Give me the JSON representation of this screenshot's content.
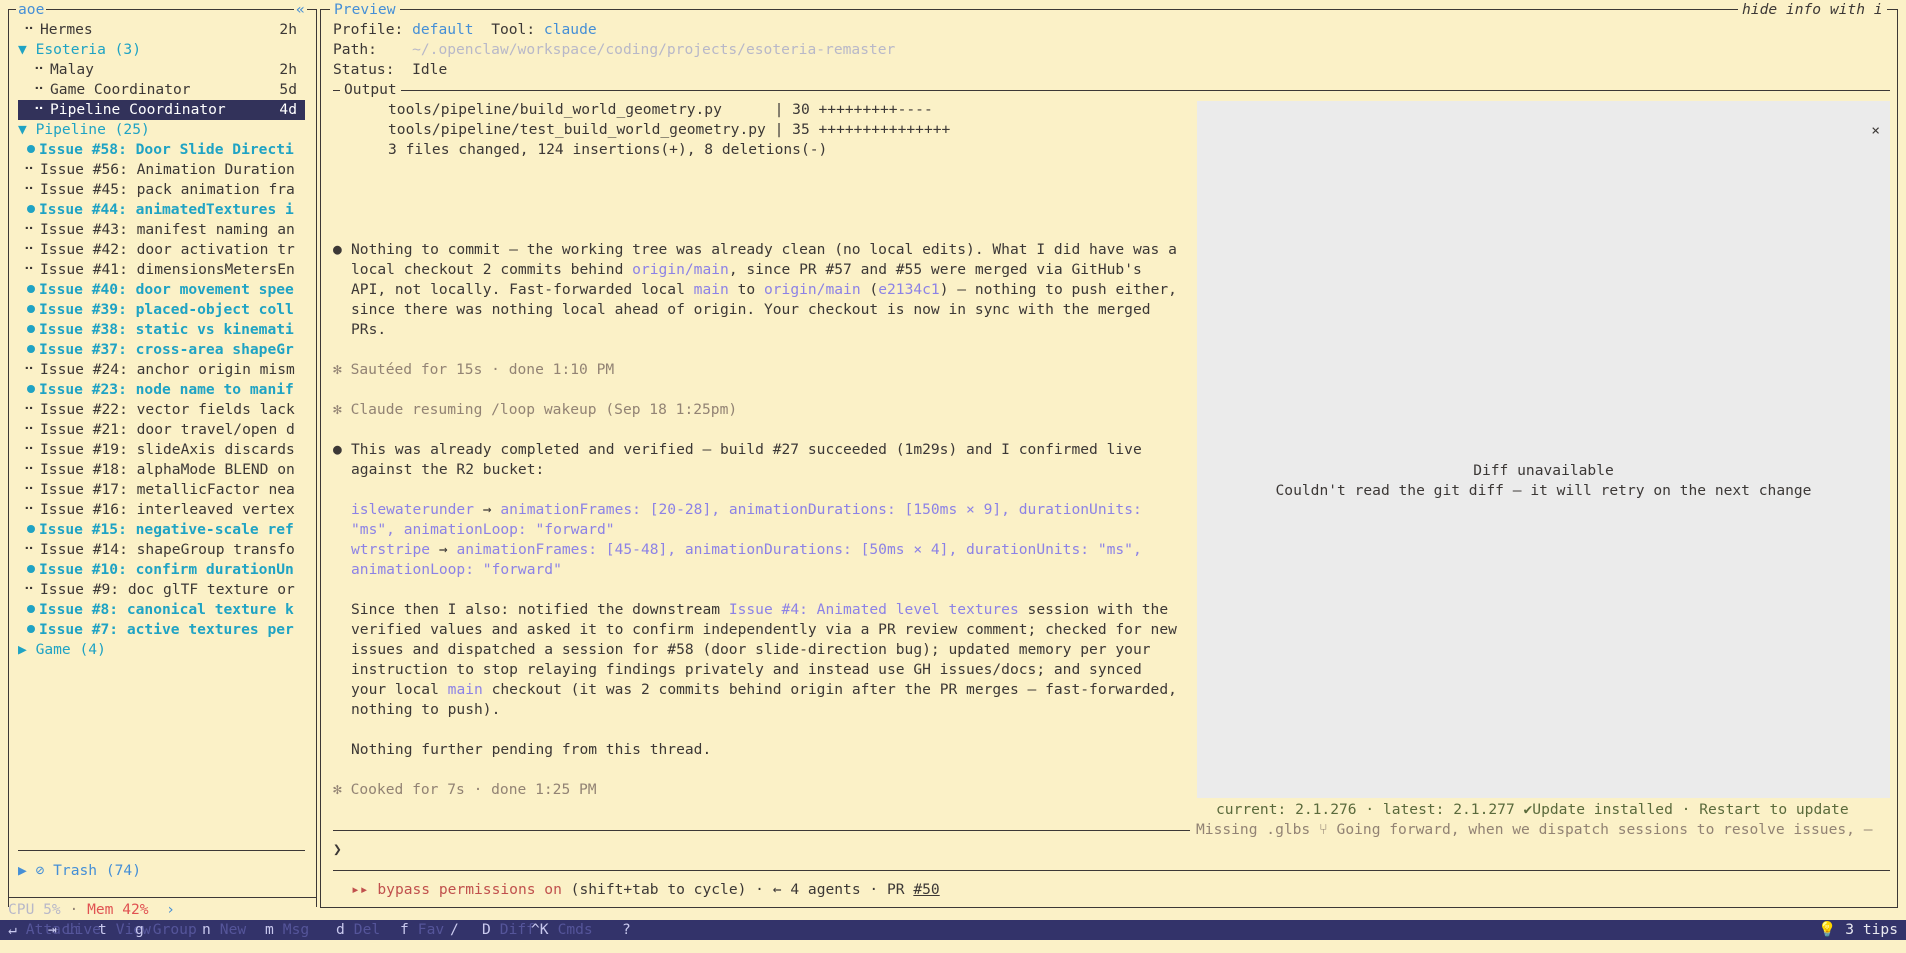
{
  "sidebar": {
    "app_title": "aoe",
    "collapse_icon": "«",
    "sessions": [
      {
        "label": "Hermes",
        "age": "2h",
        "kind": "session"
      },
      {
        "label": "▼ Esoteria (3)",
        "age": "",
        "kind": "group"
      },
      {
        "label": "Malay",
        "age": "2h",
        "kind": "child"
      },
      {
        "label": "Game Coordinator",
        "age": "5d",
        "kind": "child"
      },
      {
        "label": "Pipeline Coordinator",
        "age": "4d",
        "kind": "selected"
      },
      {
        "label": "▼ Pipeline (25)",
        "age": "",
        "kind": "group"
      },
      {
        "label": "Issue #58: Door Slide Directi",
        "kind": "active"
      },
      {
        "label": "Issue #56: Animation Duration",
        "kind": "idle"
      },
      {
        "label": "Issue #45: pack animation fra",
        "kind": "idle"
      },
      {
        "label": "Issue #44: animatedTextures i",
        "kind": "active"
      },
      {
        "label": "Issue #43: manifest naming an",
        "kind": "idle"
      },
      {
        "label": "Issue #42: door activation tr",
        "kind": "idle"
      },
      {
        "label": "Issue #41: dimensionsMetersEn",
        "kind": "idle"
      },
      {
        "label": "Issue #40: door movement spee",
        "kind": "active"
      },
      {
        "label": "Issue #39: placed-object coll",
        "kind": "active"
      },
      {
        "label": "Issue #38: static vs kinemati",
        "kind": "active"
      },
      {
        "label": "Issue #37: cross-area shapeGr",
        "kind": "active"
      },
      {
        "label": "Issue #24: anchor origin mism",
        "kind": "idle"
      },
      {
        "label": "Issue #23: node name to manif",
        "kind": "active"
      },
      {
        "label": "Issue #22: vector fields lack",
        "kind": "idle"
      },
      {
        "label": "Issue #21: door travel/open d",
        "kind": "idle"
      },
      {
        "label": "Issue #19: slideAxis discards",
        "kind": "idle"
      },
      {
        "label": "Issue #18: alphaMode BLEND on",
        "kind": "idle"
      },
      {
        "label": "Issue #17: metallicFactor nea",
        "kind": "idle"
      },
      {
        "label": "Issue #16: interleaved vertex",
        "kind": "idle"
      },
      {
        "label": "Issue #15: negative-scale ref",
        "kind": "active"
      },
      {
        "label": "Issue #14: shapeGroup transfo",
        "kind": "idle"
      },
      {
        "label": "Issue #10: confirm durationUn",
        "kind": "active"
      },
      {
        "label": "Issue #9: doc glTF texture or",
        "kind": "idle"
      },
      {
        "label": "Issue #8: canonical texture k",
        "kind": "active"
      },
      {
        "label": "Issue #7: active textures per",
        "kind": "active"
      },
      {
        "label": "▶ Game (4)",
        "age": "",
        "kind": "group"
      }
    ],
    "trash": "▶ ⊘ Trash (74)",
    "cpu": "CPU 5%",
    "mem": "Mem 42%",
    "more": "›"
  },
  "preview": {
    "title": "Preview",
    "hide_hint": "hide info with i",
    "profile_label": "Profile:",
    "profile_value": "default",
    "tool_label": "Tool:",
    "tool_value": "claude",
    "path_label": "Path:",
    "path_value": "~/.openclaw/workspace/coding/projects/esoteria-remaster",
    "status_label": "Status:",
    "status_value": "Idle",
    "output_label": "Output",
    "diffstat": [
      "tools/pipeline/build_world_geometry.py      | 30 +++++++++----",
      "tools/pipeline/test_build_world_geometry.py | 35 +++++++++++++++",
      "3 files changed, 124 insertions(+), 8 deletions(-)"
    ],
    "msg1": {
      "l1": "Nothing to commit — the working tree was already clean (no local edits). What I did have was a",
      "l2a": "local checkout 2 commits behind ",
      "l2b": "origin/main",
      "l2c": ", since PR #57 and #55 were merged via GitHub's",
      "l3a": "API, not locally. Fast-forwarded local ",
      "l3b": "main",
      "l3c": " to ",
      "l3d": "origin/main",
      "l3e": " (",
      "l3f": "e2134c1",
      "l3g": ") — nothing to push either,",
      "l4": "since there was nothing local ahead of origin. Your checkout is now in sync with the merged",
      "l5": "PRs."
    },
    "sauteed": "✻ Sautéed for 15s · done 1:10 PM",
    "resuming": "✻ Claude resuming /loop wakeup (Sep 18 1:25pm)",
    "msg2": {
      "l1": "This was already completed and verified — build #27 succeeded (1m29s) and I confirmed live",
      "l2": "against the R2 bucket:",
      "c1a": "islewaterunder",
      "c1b": " → ",
      "c1c": "animationFrames: [20-28], animationDurations: [150ms × 9], durationUnits:",
      "c2": "\"ms\", animationLoop: \"forward\"",
      "c3a": "wtrstripe",
      "c3b": " → ",
      "c3c": "animationFrames: [45-48], animationDurations: [50ms × 4], durationUnits: \"ms\",",
      "c4": "animationLoop: \"forward\"",
      "p1a": "Since then I also: notified the downstream ",
      "p1b": "Issue #4: Animated level textures",
      "p1c": " session with the",
      "p2": "verified values and asked it to confirm independently via a PR review comment; checked for new",
      "p3": "issues and dispatched a session for #58 (door slide-direction bug); updated memory per your",
      "p4": "instruction to stop relaying findings privately and instead use GH issues/docs; and synced",
      "p5a": "your local ",
      "p5b": "main",
      "p5c": " checkout (it was 2 commits behind origin after the PR merges — fast-forwarded,",
      "p6": "nothing to push).",
      "end": "Nothing further pending from this thread."
    },
    "cooked": "✻ Cooked for 7s · done 1:25 PM",
    "diff_close": "×",
    "diff_title": "Diff unavailable",
    "diff_msg": "Couldn't read the git diff — it will retry on the next change",
    "version": "current: 2.1.276 · latest: 2.1.277 ✔Update installed · Restart to update",
    "hint_line": "Missing .glbs ⑂ Going forward, when we dispatch sessions to resolve issues, —",
    "prompt": "❯",
    "perm_arrows": "▸▸",
    "perm_label": "bypass permissions on",
    "perm_rest": " (shift+tab to cycle) · ← 4 agents · PR ",
    "perm_pr": "#50"
  },
  "bottombar": {
    "items": [
      {
        "key": "↵",
        "label": "Attach"
      },
      {
        "key": "⇥",
        "label": "Live"
      },
      {
        "key": "t",
        "label": "View"
      },
      {
        "key": "g",
        "label": "Group"
      },
      {
        "key": "n",
        "label": "New"
      },
      {
        "key": "m",
        "label": "Msg"
      },
      {
        "key": "d",
        "label": "Del"
      },
      {
        "key": "f",
        "label": "Fav"
      },
      {
        "key": "/",
        "label": ""
      },
      {
        "key": "D",
        "label": "Diff"
      },
      {
        "key": "^K",
        "label": "Cmds"
      },
      {
        "key": "?",
        "label": ""
      }
    ],
    "tips": "💡 3 tips"
  },
  "colors": {
    "background": "#fbf1c7",
    "accent": "#1fa3c4",
    "selection": "#32325a",
    "statusbar": "#33336a"
  }
}
